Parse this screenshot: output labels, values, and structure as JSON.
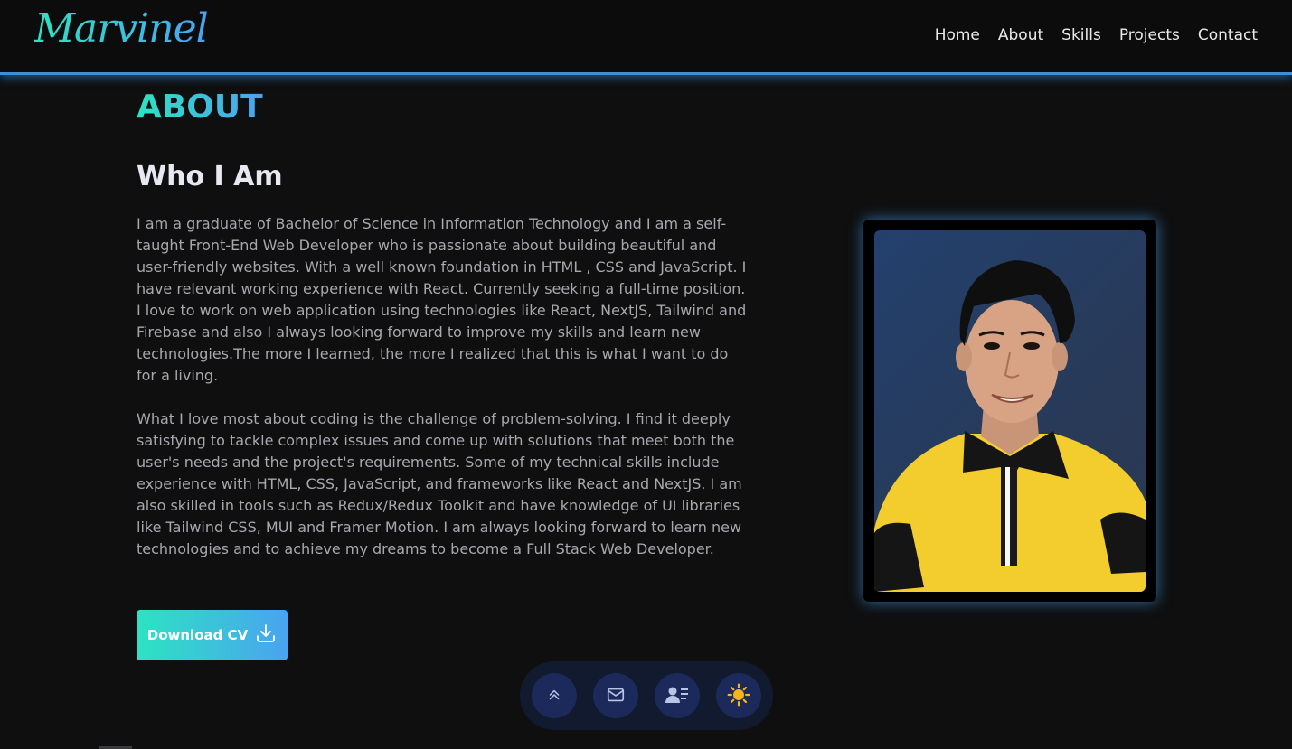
{
  "header": {
    "logo_text": "Marvinel",
    "nav": [
      {
        "label": "Home"
      },
      {
        "label": "About"
      },
      {
        "label": "Skills"
      },
      {
        "label": "Projects"
      },
      {
        "label": "Contact"
      }
    ]
  },
  "about": {
    "section_title": "ABOUT",
    "subtitle": "Who I Am",
    "paragraph1": "I am a graduate of Bachelor of Science in Information Technology and I am a self-taught Front-End Web Developer who is passionate about building beautiful and user-friendly websites. With a well known foundation in HTML , CSS and JavaScript. I have relevant working experience with React. Currently seeking a full-time position. I love to work on web application using technologies like React, NextJS, Tailwind and Firebase and also I always looking forward to improve my skills and learn new technologies.The more I learned, the more I realized that this is what I want to do for a living.",
    "paragraph2": "What I love most about coding is the challenge of problem-solving. I find it deeply satisfying to tackle complex issues and come up with solutions that meet both the user's needs and the project's requirements. Some of my technical skills include experience with HTML, CSS, JavaScript, and frameworks like React and NextJS. I am also skilled in tools such as Redux/Redux Toolkit and have knowledge of UI libraries like Tailwind CSS, MUI and Framer Motion. I am always looking forward to learn new technologies and to achieve my dreams to become a Full Stack Web Developer.",
    "download_label": "Download CV",
    "download_icon": "download-icon"
  },
  "dock": {
    "icons": [
      "double-chevron-up-icon",
      "mail-icon",
      "contact-card-icon",
      "sun-icon"
    ]
  },
  "colors": {
    "accent_start": "#2de3c2",
    "accent_end": "#4aa3f0",
    "background": "#0f0f10",
    "nav_border": "#3b8fd8",
    "sun": "#f5b41d"
  }
}
